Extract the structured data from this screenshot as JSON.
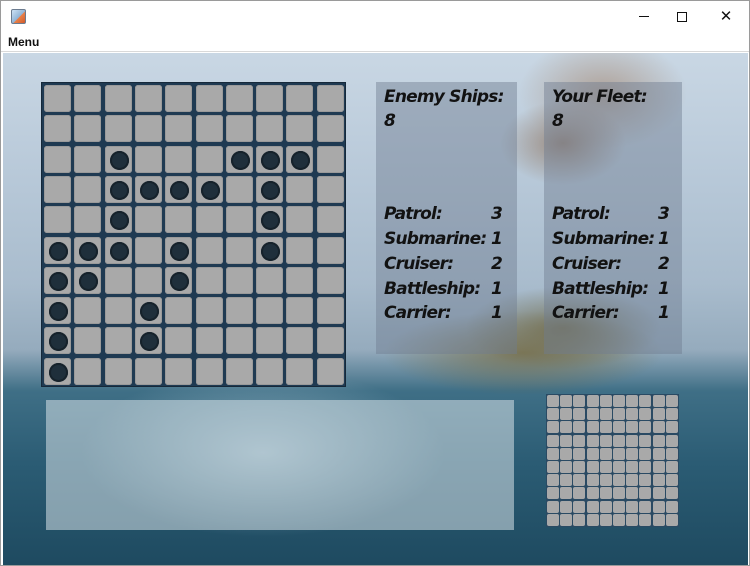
{
  "window": {
    "title": "",
    "controls": {
      "minimize_icon": "minimize-icon",
      "maximize_icon": "maximize-icon",
      "close_icon": "close-icon",
      "close_glyph": "✕"
    }
  },
  "menubar": {
    "items": [
      {
        "label": "Menu"
      }
    ]
  },
  "board": {
    "size": 10,
    "marker_color": "#1f2f3b",
    "cell_color": "#a9a9a9",
    "markers": [
      [
        2,
        2
      ],
      [
        2,
        6
      ],
      [
        2,
        7
      ],
      [
        2,
        8
      ],
      [
        3,
        2
      ],
      [
        3,
        3
      ],
      [
        3,
        4
      ],
      [
        3,
        5
      ],
      [
        3,
        7
      ],
      [
        4,
        2
      ],
      [
        4,
        7
      ],
      [
        5,
        0
      ],
      [
        5,
        1
      ],
      [
        5,
        2
      ],
      [
        5,
        4
      ],
      [
        5,
        7
      ],
      [
        6,
        0
      ],
      [
        6,
        1
      ],
      [
        6,
        4
      ],
      [
        7,
        0
      ],
      [
        7,
        3
      ],
      [
        8,
        0
      ],
      [
        8,
        3
      ],
      [
        9,
        0
      ]
    ]
  },
  "enemy_panel": {
    "heading": "Enemy Ships:",
    "count": "8",
    "rows": [
      {
        "label": "Patrol:",
        "value": "3"
      },
      {
        "label": "Submarine:",
        "value": "1"
      },
      {
        "label": "Cruiser:",
        "value": "2"
      },
      {
        "label": "Battleship:",
        "value": "1"
      },
      {
        "label": "Carrier:",
        "value": "1"
      }
    ]
  },
  "fleet_panel": {
    "heading": "Your Fleet:",
    "count": "8",
    "rows": [
      {
        "label": "Patrol:",
        "value": "3"
      },
      {
        "label": "Submarine:",
        "value": "1"
      },
      {
        "label": "Cruiser:",
        "value": "2"
      },
      {
        "label": "Battleship:",
        "value": "1"
      },
      {
        "label": "Carrier:",
        "value": "1"
      }
    ]
  },
  "message_box": {
    "text": ""
  },
  "mini_board": {
    "size": 10
  }
}
